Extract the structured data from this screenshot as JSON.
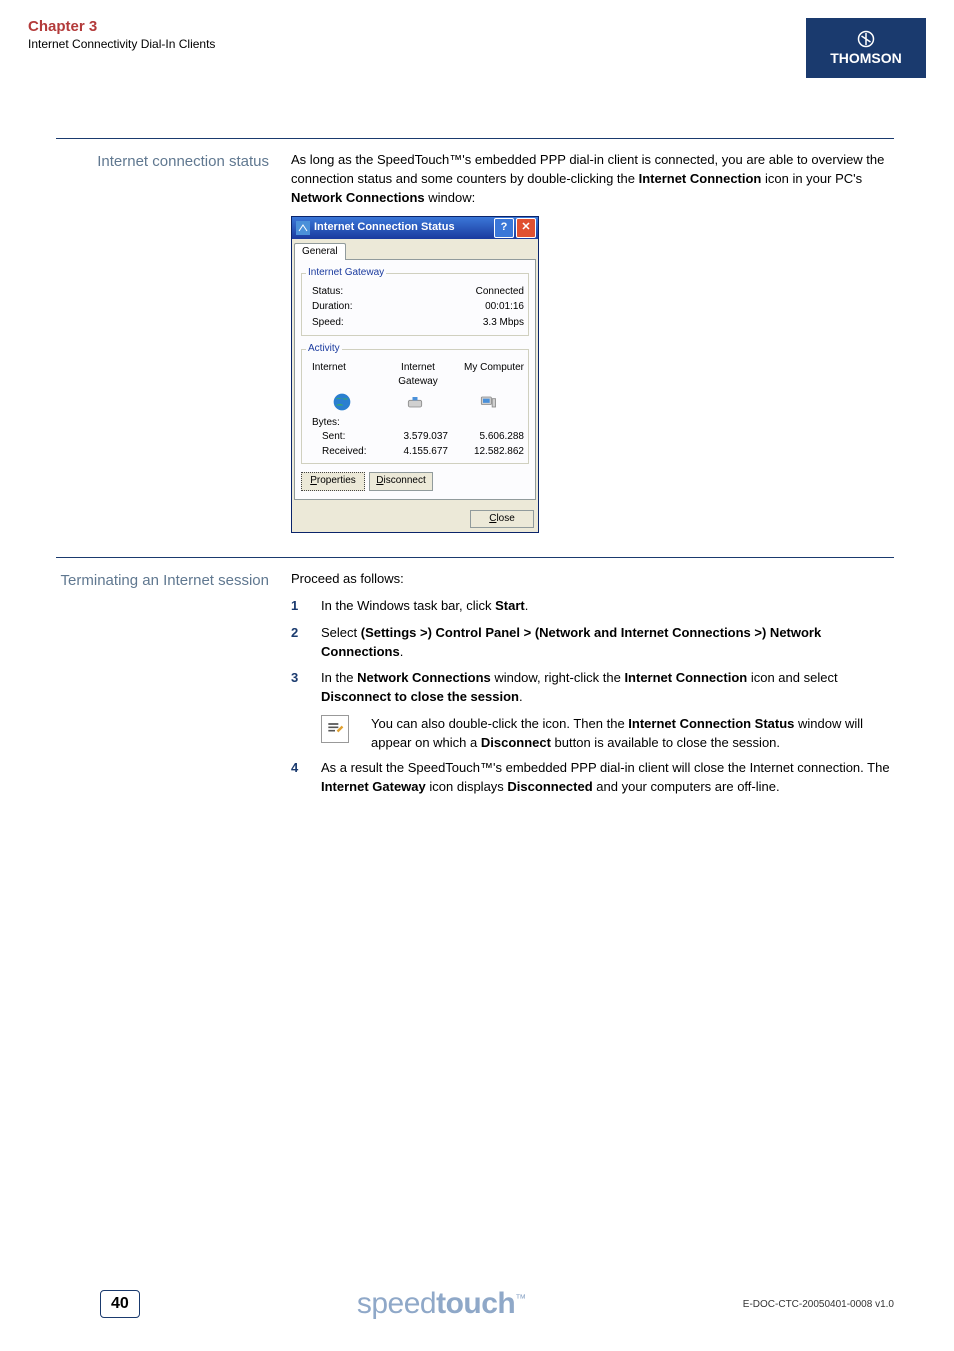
{
  "header": {
    "chapter": "Chapter 3",
    "subtitle": "Internet Connectivity Dial-In Clients",
    "logo_text": "THOMSON"
  },
  "section1": {
    "label": "Internet connection status",
    "para_pre": "As long as the SpeedTouch™'s embedded PPP dial-in client is connected, you are able to overview the connection status and some counters by double-clicking the ",
    "para_b1": "Internet Connection",
    "para_mid": " icon in your PC's ",
    "para_b2": "Network Connections",
    "para_post": " window:"
  },
  "dialog": {
    "title": "Internet Connection Status",
    "tab_general": "General",
    "group_gateway": "Internet Gateway",
    "status_label": "Status:",
    "status_value": "Connected",
    "duration_label": "Duration:",
    "duration_value": "00:01:16",
    "speed_label": "Speed:",
    "speed_value": "3.3 Mbps",
    "group_activity": "Activity",
    "col_internet": "Internet",
    "col_gateway": "Internet Gateway",
    "col_mycomputer": "My Computer",
    "bytes_label": "Bytes:",
    "sent_label": "Sent:",
    "received_label": "Received:",
    "sent_gw": "3.579.037",
    "recv_gw": "4.155.677",
    "sent_pc": "5.606.288",
    "recv_pc": "12.582.862",
    "btn_properties": "Properties",
    "btn_disconnect": "Disconnect",
    "btn_close": "Close"
  },
  "section2": {
    "label": "Terminating an Internet session",
    "intro": "Proceed as follows:",
    "step1_pre": "In the Windows task bar, click ",
    "step1_b": "Start",
    "step1_post": ".",
    "step2_pre": "Select ",
    "step2_b": "(Settings >) Control Panel > (Network and Internet Connections >) Network Connections",
    "step2_post": ".",
    "step3_pre": "In the ",
    "step3_b1": "Network Connections",
    "step3_mid1": " window, right-click the ",
    "step3_b2": "Internet Connection",
    "step3_mid2": " icon and select ",
    "step3_b3": "Disconnect to close the session",
    "step3_post": ".",
    "note_pre": "You can also double-click the icon. Then the ",
    "note_b1": "Internet Connection Status",
    "note_mid1": " window will appear on which a ",
    "note_b2": "Disconnect",
    "note_post": " button is available to close the session.",
    "step4_pre": "As a result the SpeedTouch™'s embedded PPP dial-in client will close the Internet connection. The ",
    "step4_b1": "Internet Gateway",
    "step4_mid": " icon displays ",
    "step4_b2": "Disconnected",
    "step4_post": " and your computers are off-line."
  },
  "footer": {
    "page": "40",
    "brand_pre": "speed",
    "brand_bold": "touch",
    "docid": "E-DOC-CTC-20050401-0008 v1.0"
  }
}
